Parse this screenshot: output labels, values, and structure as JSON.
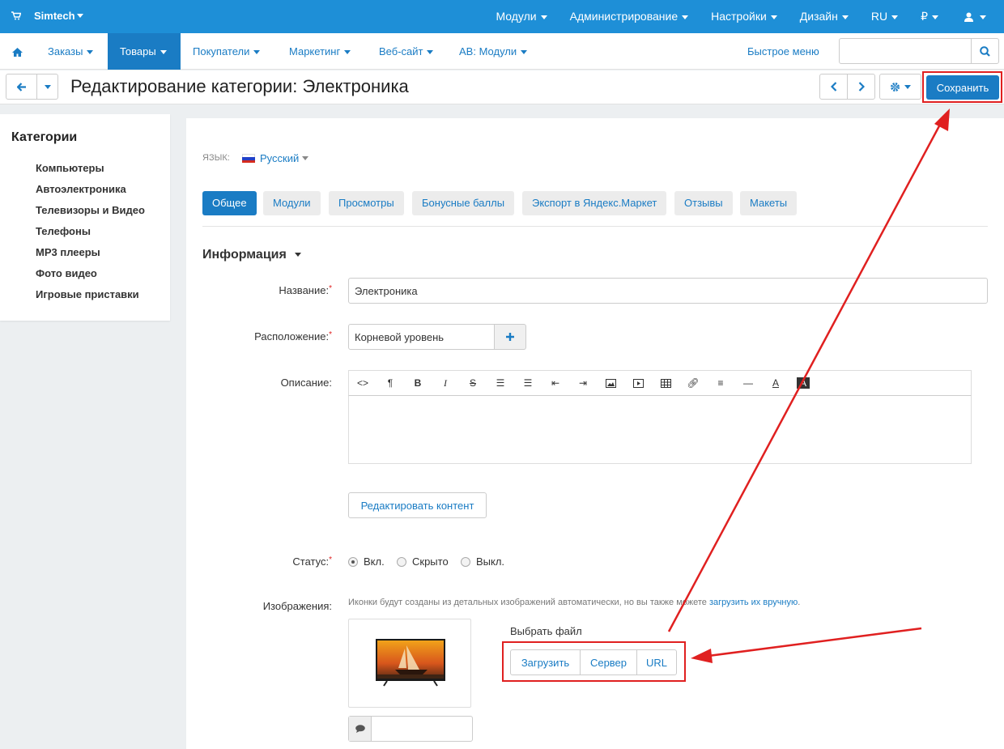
{
  "topbar": {
    "brand": "Simtech",
    "menu": [
      "Модули",
      "Администрирование",
      "Настройки",
      "Дизайн",
      "RU",
      "₽"
    ],
    "colors": {
      "bg": "#1e8fd7"
    }
  },
  "nav": {
    "items": [
      "Заказы",
      "Товары",
      "Покупатели",
      "Маркетинг",
      "Веб-сайт",
      "AB: Модули"
    ],
    "active": "Товары",
    "quick_menu": "Быстрое меню"
  },
  "titlebar": {
    "title": "Редактирование категории: Электроника",
    "save_label": "Сохранить"
  },
  "sidebar": {
    "title": "Категории",
    "items": [
      "Компьютеры",
      "Автоэлектроника",
      "Телевизоры и Видео",
      "Телефоны",
      "MP3 плееры",
      "Фото видео",
      "Игровые приставки"
    ]
  },
  "main": {
    "lang_label": "ЯЗЫК:",
    "lang_value": "Русский",
    "tabs": [
      "Общее",
      "Модули",
      "Просмотры",
      "Бонусные баллы",
      "Экспорт в Яндекс.Маркет",
      "Отзывы",
      "Макеты"
    ],
    "section_title": "Информация",
    "fields": {
      "name_label": "Название:",
      "name_value": "Электроника",
      "location_label": "Расположение:",
      "location_value": "Корневой уровень",
      "description_label": "Описание:",
      "edit_content": "Редактировать контент",
      "status_label": "Статус:",
      "status_options": [
        "Вкл.",
        "Скрыто",
        "Выкл."
      ],
      "status_selected": "Вкл.",
      "images_label": "Изображения:",
      "images_hint": "Иконки будут созданы из детальных изображений автоматически, но вы также можете",
      "images_hint_link": "загрузить их вручную",
      "images_hint_end": ".",
      "choose_file": "Выбрать файл",
      "upload_buttons": [
        "Загрузить",
        "Сервер",
        "URL"
      ]
    }
  },
  "colors": {
    "accent": "#1a7cc4",
    "annotation": "#e02020"
  }
}
